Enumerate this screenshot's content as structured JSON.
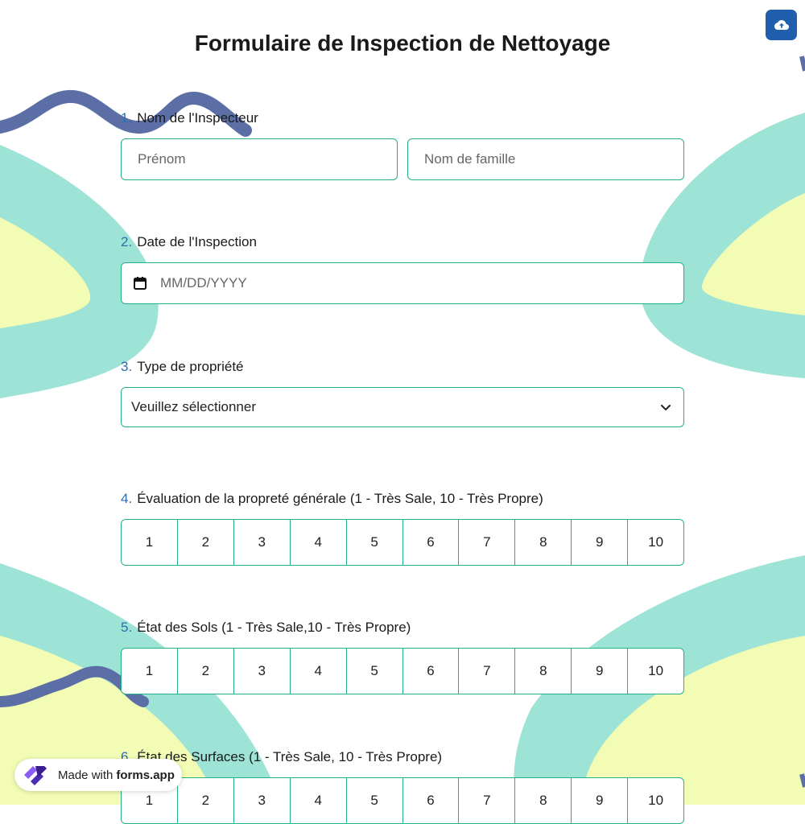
{
  "form": {
    "title": "Formulaire de Inspection de Nettoyage",
    "questions": [
      {
        "number": "1.",
        "label": "Nom de l'Inspecteur",
        "fields": [
          {
            "placeholder": "Prénom"
          },
          {
            "placeholder": "Nom de famille"
          }
        ]
      },
      {
        "number": "2.",
        "label": "Date de l'Inspection",
        "placeholder": "MM/DD/YYYY",
        "icon": "calendar-icon"
      },
      {
        "number": "3.",
        "label": "Type de propriété",
        "selected": "Veuillez sélectionner",
        "icon": "chevron-down-icon"
      },
      {
        "number": "4.",
        "label": "Évaluation de la propreté générale (1 - Très Sale, 10 - Très Propre)",
        "options": [
          "1",
          "2",
          "3",
          "4",
          "5",
          "6",
          "7",
          "8",
          "9",
          "10"
        ]
      },
      {
        "number": "5.",
        "label": "État des Sols (1 - Très Sale,10 - Très Propre)",
        "options": [
          "1",
          "2",
          "3",
          "4",
          "5",
          "6",
          "7",
          "8",
          "9",
          "10"
        ]
      },
      {
        "number": "6.",
        "label": "État des Surfaces (1 - Très Sale, 10 - Très Propre)",
        "options": [
          "1",
          "2",
          "3",
          "4",
          "5",
          "6",
          "7",
          "8",
          "9",
          "10"
        ]
      }
    ]
  },
  "upload_button": {
    "icon": "cloud-upload-icon"
  },
  "badge": {
    "prefix": "Made with",
    "brand": "forms.app",
    "icon": "forms-app-logo-icon"
  },
  "colors": {
    "accent": "#22b08a",
    "number": "#2a6fb0",
    "button": "#1f5fae",
    "teal": "#9de3d6",
    "yellow": "#f2fcb4",
    "navy": "#5b6fa6"
  }
}
